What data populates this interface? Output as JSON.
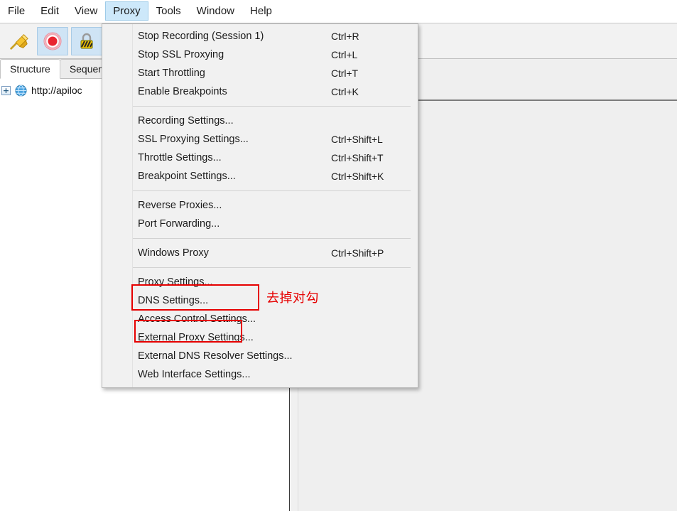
{
  "menubar": {
    "items": [
      {
        "label": "File",
        "active": false
      },
      {
        "label": "Edit",
        "active": false
      },
      {
        "label": "View",
        "active": false
      },
      {
        "label": "Proxy",
        "active": true
      },
      {
        "label": "Tools",
        "active": false
      },
      {
        "label": "Window",
        "active": false
      },
      {
        "label": "Help",
        "active": false
      }
    ]
  },
  "toolbar": {
    "buttons": [
      {
        "icon": "broom-icon",
        "name": "clear-session-button",
        "toggled": false
      },
      {
        "icon": "record-icon",
        "name": "record-button",
        "toggled": true
      },
      {
        "icon": "lock-icon",
        "name": "ssl-proxying-button",
        "toggled": true
      }
    ]
  },
  "left_panel": {
    "tabs": [
      {
        "label": "Structure",
        "active": true
      },
      {
        "label": "Sequen",
        "active": false
      }
    ],
    "tree": [
      {
        "expander": "+",
        "icon": "globe-icon",
        "label": "http://apiloc"
      }
    ]
  },
  "proxy_menu": {
    "groups": [
      {
        "items": [
          {
            "label": "Stop Recording (Session 1)",
            "accel": "Ctrl+R",
            "name": "menu-stop-recording"
          },
          {
            "label": "Stop SSL Proxying",
            "accel": "Ctrl+L",
            "name": "menu-stop-ssl-proxying"
          },
          {
            "label": "Start Throttling",
            "accel": "Ctrl+T",
            "name": "menu-start-throttling"
          },
          {
            "label": "Enable Breakpoints",
            "accel": "Ctrl+K",
            "name": "menu-enable-breakpoints"
          }
        ]
      },
      {
        "items": [
          {
            "label": "Recording Settings...",
            "accel": "",
            "name": "menu-recording-settings"
          },
          {
            "label": "SSL Proxying Settings...",
            "accel": "Ctrl+Shift+L",
            "name": "menu-ssl-proxying-settings"
          },
          {
            "label": "Throttle Settings...",
            "accel": "Ctrl+Shift+T",
            "name": "menu-throttle-settings"
          },
          {
            "label": "Breakpoint Settings...",
            "accel": "Ctrl+Shift+K",
            "name": "menu-breakpoint-settings"
          }
        ]
      },
      {
        "items": [
          {
            "label": "Reverse Proxies...",
            "accel": "",
            "name": "menu-reverse-proxies"
          },
          {
            "label": "Port Forwarding...",
            "accel": "",
            "name": "menu-port-forwarding"
          }
        ]
      },
      {
        "items": [
          {
            "label": "Windows Proxy",
            "accel": "Ctrl+Shift+P",
            "name": "menu-windows-proxy"
          }
        ]
      },
      {
        "items": [
          {
            "label": "Proxy Settings...",
            "accel": "",
            "name": "menu-proxy-settings"
          },
          {
            "label": "DNS Settings...",
            "accel": "",
            "name": "menu-dns-settings"
          },
          {
            "label": "Access Control Settings...",
            "accel": "",
            "name": "menu-access-control-settings"
          },
          {
            "label": "External Proxy Settings...",
            "accel": "",
            "name": "menu-external-proxy-settings"
          },
          {
            "label": "External DNS Resolver Settings...",
            "accel": "",
            "name": "menu-external-dns-resolver-settings"
          },
          {
            "label": "Web Interface Settings...",
            "accel": "",
            "name": "menu-web-interface-settings"
          }
        ]
      }
    ]
  },
  "annotations": {
    "note_text": "去掉对勾",
    "color": "#e60000"
  }
}
